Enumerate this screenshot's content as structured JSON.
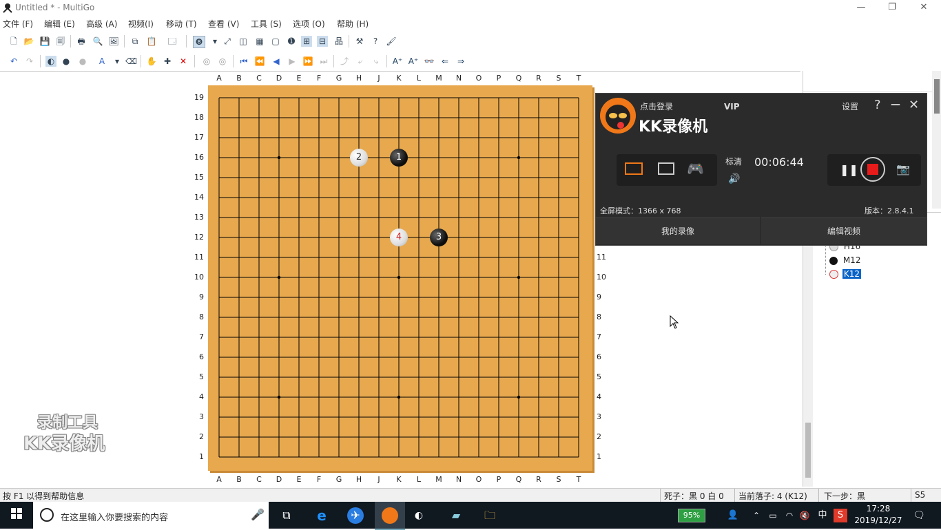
{
  "window": {
    "title": "Untitled  * - MultiGo",
    "minimize": "—",
    "restore": "❐",
    "close": "✕"
  },
  "menu": [
    "文件 (F)",
    "编辑 (E)",
    "高级 (A)",
    "视频(I)",
    "移动 (T)",
    "查看 (V)",
    "工具 (S)",
    "选项 (O)",
    "帮助 (H)"
  ],
  "board": {
    "columns": [
      "A",
      "B",
      "C",
      "D",
      "E",
      "F",
      "G",
      "H",
      "J",
      "K",
      "L",
      "M",
      "N",
      "O",
      "P",
      "Q",
      "R",
      "S",
      "T"
    ],
    "rows": [
      "19",
      "18",
      "17",
      "16",
      "15",
      "14",
      "13",
      "12",
      "11",
      "10",
      "9",
      "8",
      "7",
      "6",
      "5",
      "4",
      "3",
      "2",
      "1"
    ],
    "right_rows": [
      "11",
      "10",
      "9",
      "8",
      "7",
      "6",
      "5",
      "4",
      "3",
      "2",
      "1"
    ],
    "stones": [
      {
        "number": "1",
        "color": "black",
        "col": "K",
        "row": 16
      },
      {
        "number": "2",
        "color": "white",
        "col": "H",
        "row": 16
      },
      {
        "number": "3",
        "color": "black",
        "col": "M",
        "row": 12
      },
      {
        "number": "4",
        "color": "white",
        "col": "K",
        "row": 12,
        "last": true
      }
    ]
  },
  "move_tree": {
    "items": [
      {
        "label": "H16",
        "color": "white"
      },
      {
        "label": "M12",
        "color": "black"
      },
      {
        "label": "K12",
        "color": "white",
        "selected": true
      }
    ]
  },
  "kk_recorder": {
    "login": "点击登录",
    "vip": "VIP",
    "settings": "设置",
    "help": "?",
    "minimize": "—",
    "close": "✕",
    "brand": "KK录像机",
    "quality": "标清",
    "timer": "00:06:44",
    "mode": "全屏模式：1366 x 768",
    "version": "版本：2.8.4.1",
    "my_videos": "我的录像",
    "edit_video": "编辑视频"
  },
  "watermark": {
    "line1": "录制工具",
    "line2": "KK录像机"
  },
  "statusbar": {
    "help": "按 F1 以得到帮助信息",
    "captures": "死子：黑 0 白 0",
    "current_move": "当前落子: 4 (K12)",
    "next": "下一步：黑",
    "extra": "S5"
  },
  "taskbar": {
    "search_placeholder": "在这里输入你要搜索的内容",
    "battery": "95%",
    "ime": "中",
    "time": "17:28",
    "date": "2019/12/27"
  },
  "colors": {
    "board": "#e7a84e",
    "taskbar": "#101820",
    "kk_bg": "#2b2b2b",
    "record_red": "#e81b1b",
    "kk_orange": "#f07818"
  }
}
